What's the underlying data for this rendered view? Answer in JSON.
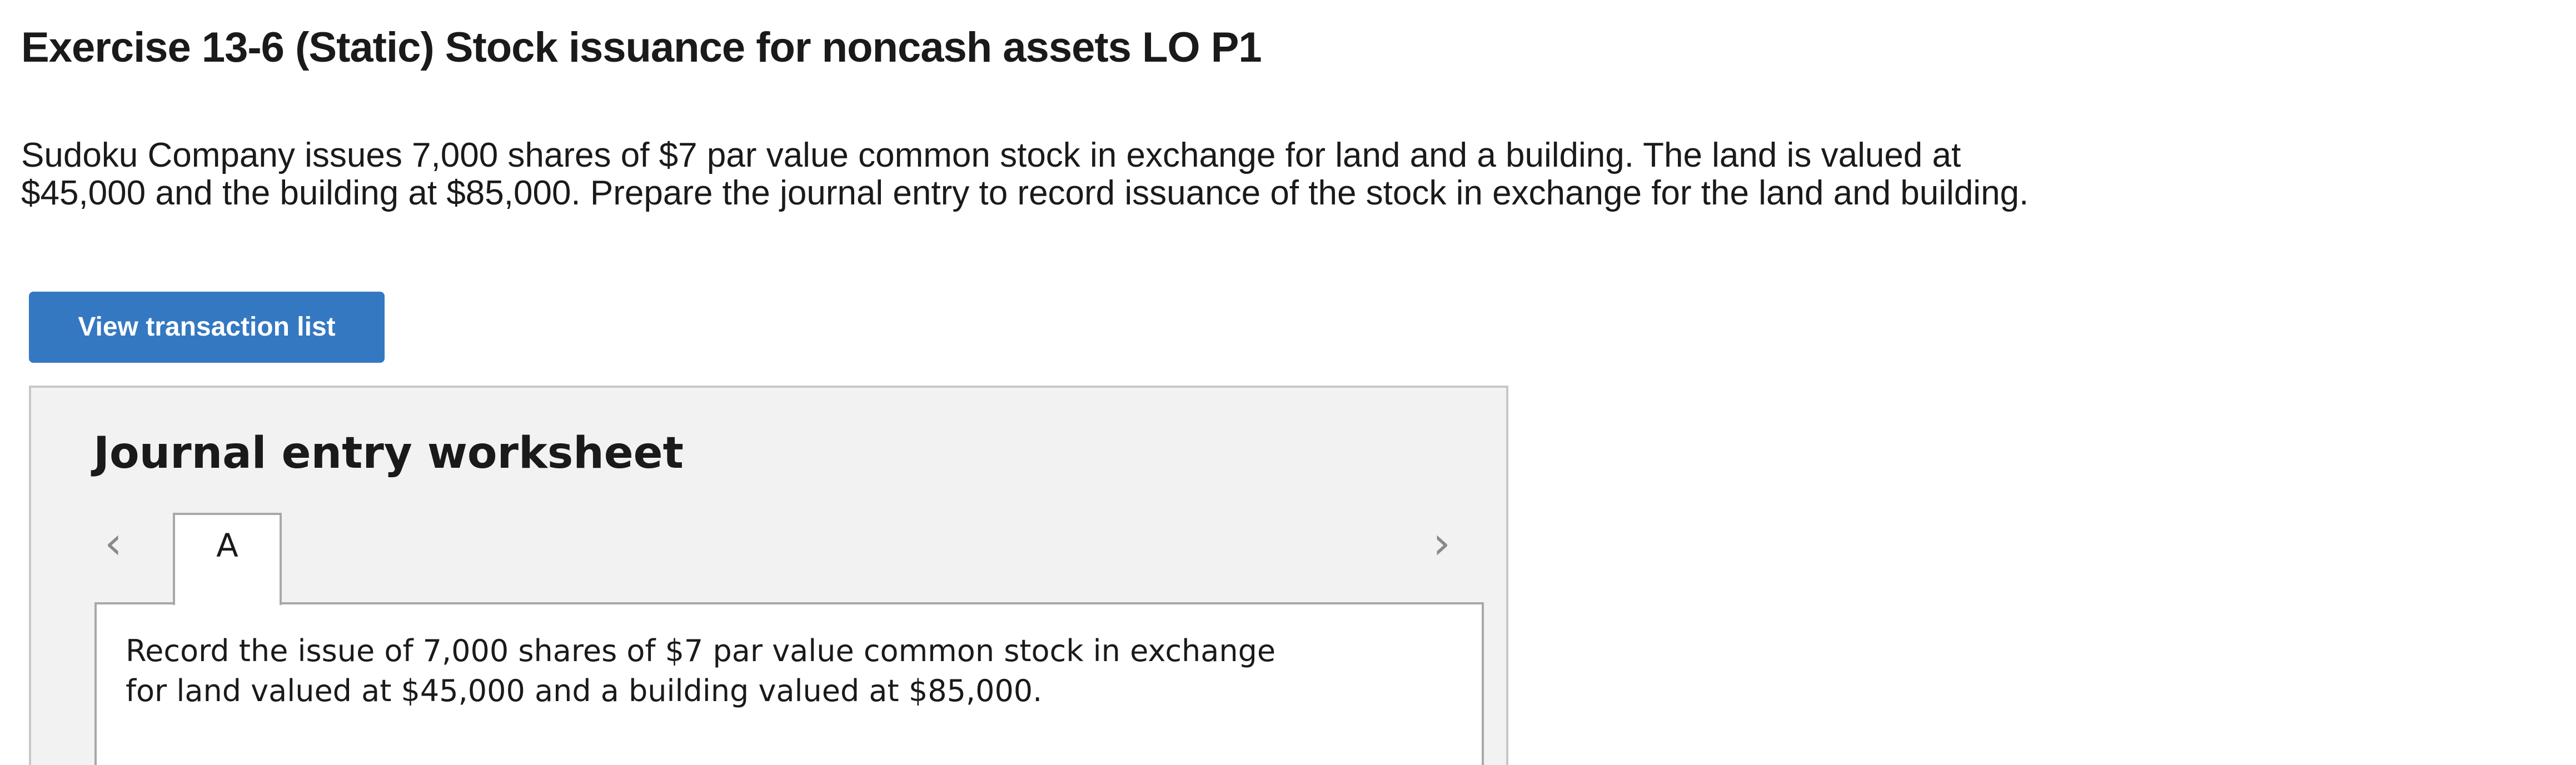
{
  "exercise": {
    "title": "Exercise 13-6 (Static) Stock issuance for noncash assets LO P1",
    "prompt_lines": [
      "Sudoku Company issues 7,000 shares of $7 par value common stock in exchange for land and a building. The land is valued at",
      "$45,000 and the building at $85,000. Prepare the journal entry to record issuance of the stock in exchange for the land and building."
    ]
  },
  "actions": {
    "view_transaction_list": "View transaction list"
  },
  "worksheet": {
    "title": "Journal entry worksheet",
    "tabs": [
      {
        "label": "A",
        "selected": true
      }
    ],
    "prev_icon": "chevron-left-icon",
    "next_icon": "chevron-right-icon",
    "instruction_lines": [
      "Record the issue of 7,000 shares of $7 par value common stock in exchange",
      "for land valued at $45,000 and a building valued at $85,000."
    ]
  },
  "colors": {
    "button": "#3478c2",
    "worksheet_background": "#f2f2f2",
    "border": "#a8a8a8"
  }
}
